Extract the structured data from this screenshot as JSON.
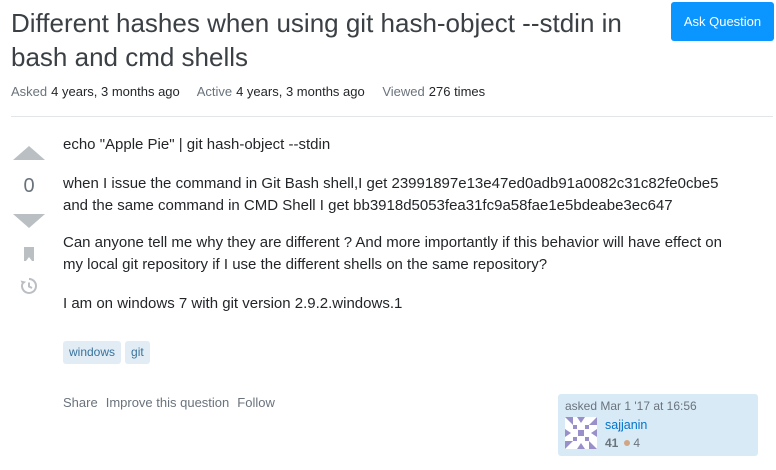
{
  "question": {
    "title": "Different hashes when using git hash-object --stdin in bash and cmd shells",
    "ask_button_label": "Ask Question",
    "meta": {
      "asked_label": "Asked",
      "asked_value": "4 years, 3 months ago",
      "active_label": "Active",
      "active_value": "4 years, 3 months ago",
      "viewed_label": "Viewed",
      "viewed_value": "276 times"
    },
    "vote_count": "0",
    "body": {
      "p1": "echo \"Apple Pie\" | git hash-object --stdin",
      "p2_line1": "when I issue the command in Git Bash shell,I get 23991897e13e47ed0adb91a0082c31c82fe0cbe5",
      "p2_line2": "and the same command in CMD Shell I get bb3918d5053fea31fc9a58fae1e5bdeabe3ec647",
      "p3_line1": "Can anyone tell me why they are different ? And more importantly if this behavior will have effect on",
      "p3_line2": "my local git repository if I use the different shells on the same repository?",
      "p4": "I am on windows 7 with git version 2.9.2.windows.1"
    },
    "tags": [
      "windows",
      "git"
    ],
    "actions": {
      "share": "Share",
      "improve": "Improve this question",
      "follow": "Follow"
    },
    "owner": {
      "asked_text": "asked Mar 1 '17 at 16:56",
      "name": "sajjanin",
      "reputation": "41",
      "bronze_badges": "4"
    }
  },
  "colors": {
    "accent": "#0a95ff",
    "tag_bg": "#e1ecf4",
    "tag_text": "#39739d",
    "owner_card_bg": "#d9eaf7"
  },
  "icons": {
    "upvote": "upvote-arrow-icon",
    "downvote": "downvote-arrow-icon",
    "bookmark": "bookmark-icon",
    "history": "history-icon"
  }
}
